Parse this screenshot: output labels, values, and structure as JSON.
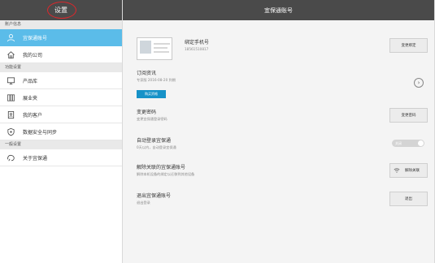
{
  "sidebar": {
    "title": "设置",
    "sections": [
      {
        "label": "账户信息"
      },
      {
        "label": "功能设置"
      },
      {
        "label": "一般设置"
      }
    ],
    "items": [
      {
        "label": "宜保通账号",
        "icon": "user-icon"
      },
      {
        "label": "我的公司",
        "icon": "home-icon"
      },
      {
        "label": "产品库",
        "icon": "monitor-icon"
      },
      {
        "label": "展业夹",
        "icon": "folder-icon"
      },
      {
        "label": "我的客户",
        "icon": "contacts-icon"
      },
      {
        "label": "数据安全与同步",
        "icon": "shield-icon"
      },
      {
        "label": "关于宜保通",
        "icon": "info-icon"
      }
    ]
  },
  "main": {
    "header_title": "宜保通账号",
    "bind_phone": {
      "title": "绑定手机号",
      "phone": "18561510817",
      "button": "变更绑定"
    },
    "subscription": {
      "title": "订阅资讯",
      "subtitle": "专家版 2016-08-20 到期",
      "button": "购买资格"
    },
    "change_password": {
      "title": "变更密码",
      "subtitle": "变更宜保通登录密码",
      "button": "变更密码"
    },
    "auto_login": {
      "title": "自动登录宜保通",
      "subtitle": "0天以内，自动登录宜保通",
      "toggle_label": "关闭"
    },
    "unlink": {
      "title": "解除关联的宜保通账号",
      "subtitle": "解除本机设备的绑定以迁移到其他设备",
      "button": "解除关联"
    },
    "logout": {
      "title": "退出宜保通账号",
      "subtitle": "退出登录",
      "button": "退出"
    }
  }
}
